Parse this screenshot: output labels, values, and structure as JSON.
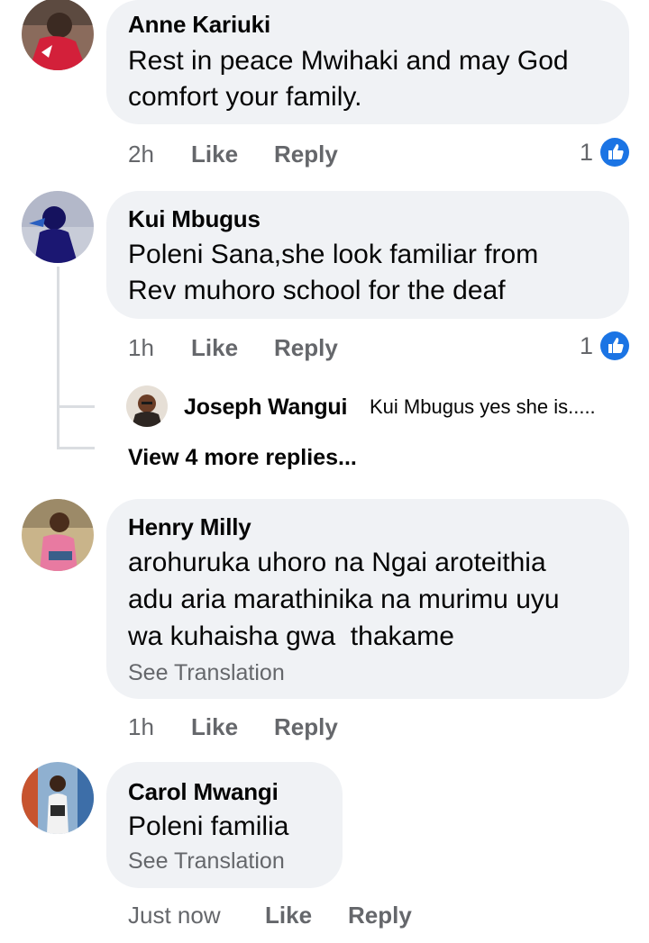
{
  "colors": {
    "bubble_bg": "#f0f2f5",
    "meta_text": "#65676b",
    "like_blue": "#1b74e4",
    "thread_line": "#dadde1"
  },
  "comments": [
    {
      "author": "Anne Kariuki",
      "lines": [
        "Rest in peace Mwihaki and may God",
        "comfort your family."
      ],
      "time": "2h",
      "like_label": "Like",
      "reply_label": "Reply",
      "reaction_count": "1",
      "reaction_icon": "thumbs-up-icon",
      "avatar_icon": "user-photo"
    },
    {
      "author": "Kui Mbugus",
      "lines": [
        "Poleni Sana,she look familiar from",
        "Rev muhoro school for the deaf"
      ],
      "time": "1h",
      "like_label": "Like",
      "reply_label": "Reply",
      "reaction_count": "1",
      "reaction_icon": "thumbs-up-icon",
      "avatar_icon": "user-photo",
      "reply_preview": {
        "author": "Joseph Wangui",
        "text": "Kui Mbugus yes she is....."
      },
      "view_more_label": "View 4 more replies..."
    },
    {
      "author": "Henry Milly",
      "lines": [
        "arohuruka uhoro na Ngai aroteithia",
        "adu aria marathinika na murimu uyu",
        "wa kuhaisha gwa  thakame"
      ],
      "see_translation": "See Translation",
      "time": "1h",
      "like_label": "Like",
      "reply_label": "Reply",
      "avatar_icon": "user-photo"
    },
    {
      "author": "Carol Mwangi",
      "lines": [
        "Poleni familia"
      ],
      "see_translation": "See Translation",
      "time": "Just now",
      "like_label": "Like",
      "reply_label": "Reply",
      "avatar_icon": "user-photo"
    }
  ]
}
